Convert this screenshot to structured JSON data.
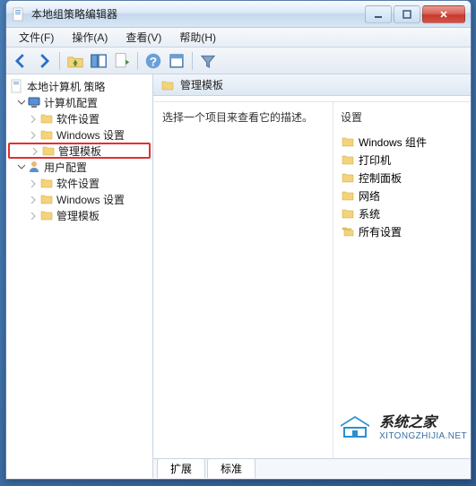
{
  "window": {
    "title": "本地组策略编辑器"
  },
  "menu": {
    "file": "文件(F)",
    "action": "操作(A)",
    "view": "查看(V)",
    "help": "帮助(H)"
  },
  "tree": {
    "root": "本地计算机 策略",
    "computer": "计算机配置",
    "user": "用户配置",
    "software": "软件设置",
    "windows": "Windows 设置",
    "admin": "管理模板"
  },
  "detail": {
    "header": "管理模板",
    "description": "选择一个项目来查看它的描述。",
    "settings_header": "设置",
    "items": [
      "Windows 组件",
      "打印机",
      "控制面板",
      "网络",
      "系统",
      "所有设置"
    ]
  },
  "tabs": {
    "extended": "扩展",
    "standard": "标准"
  },
  "watermark": {
    "title": "系统之家",
    "sub": "XITONGZHIJIA.NET"
  }
}
